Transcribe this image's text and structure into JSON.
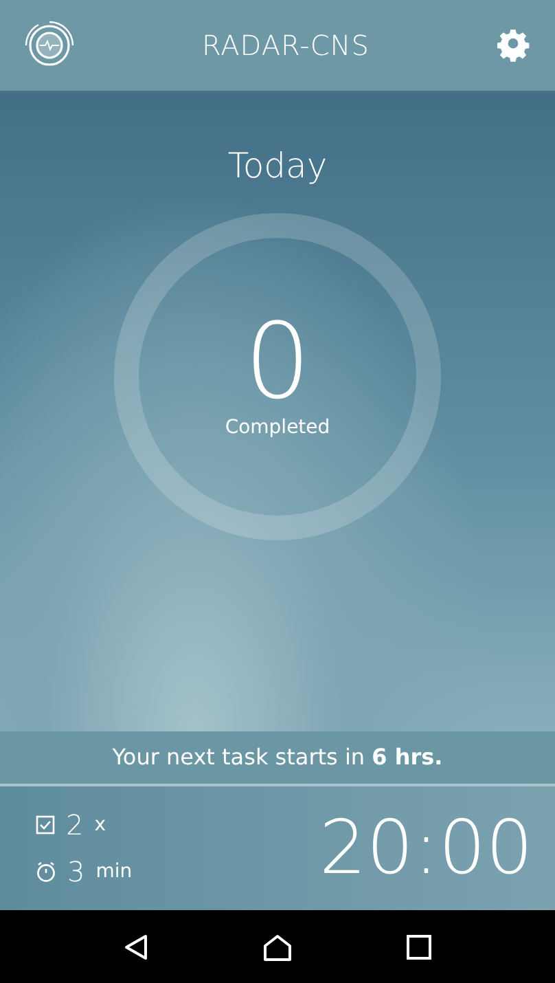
{
  "header": {
    "title": "RADAR-CNS"
  },
  "today": {
    "title": "Today",
    "count": "0",
    "caption": "Completed"
  },
  "next_task": {
    "message": "Your next task starts in **6 hrs.**"
  },
  "task_info": [
    {
      "kind": "count",
      "value": "2",
      "unit": "x"
    },
    {
      "kind": "duration",
      "value": "3",
      "unit": "min"
    }
  ],
  "task_time": "20:00"
}
